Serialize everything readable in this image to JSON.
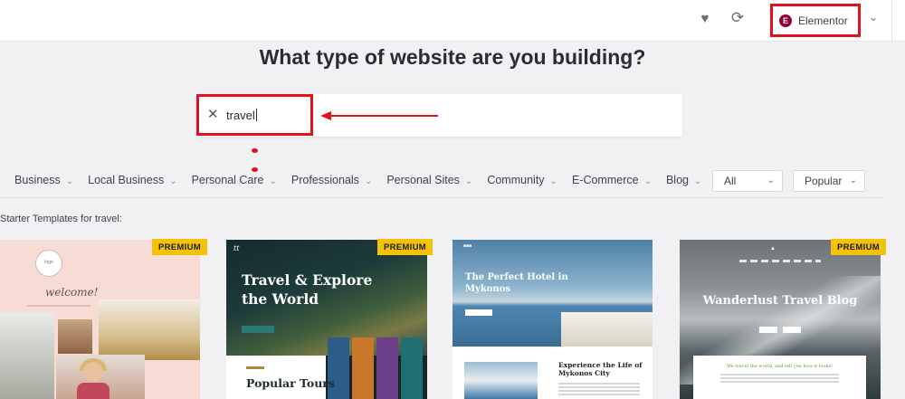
{
  "topbar": {
    "favorites_icon": "heart-icon",
    "sync_icon": "sync-icon",
    "builder_icon": "elementor-logo-icon",
    "builder_logo_letter": "E",
    "builder_label": "Elementor",
    "builder_dropdown_icon": "chevron-down-icon"
  },
  "page_title": "What type of website are you building?",
  "search": {
    "clear_icon": "close-icon",
    "value": "travel"
  },
  "categories": [
    {
      "label": "Business"
    },
    {
      "label": "Local Business"
    },
    {
      "label": "Personal Care"
    },
    {
      "label": "Professionals"
    },
    {
      "label": "Personal Sites"
    },
    {
      "label": "Community"
    },
    {
      "label": "E-Commerce"
    },
    {
      "label": "Blog"
    }
  ],
  "filters": {
    "type_selected": "All",
    "sort_selected": "Popular"
  },
  "results_label": "Starter Templates for travel:",
  "templates": [
    {
      "badge": "PREMIUM",
      "welcome": "welcome!"
    },
    {
      "badge": "PREMIUM",
      "title": "Travel & Explore the World",
      "section_title": "Popular Tours"
    },
    {
      "title": "The Perfect Hotel in Mykonos",
      "subtitle": "Experience the Life of Mykonos City"
    },
    {
      "badge": "PREMIUM",
      "title": "Wanderlust Travel Blog",
      "tagline": "We travel the world, and tell you how it looks!"
    }
  ],
  "colors": {
    "highlight": "#e0121b",
    "premium_badge": "#f3c209",
    "elementor": "#92003b"
  }
}
